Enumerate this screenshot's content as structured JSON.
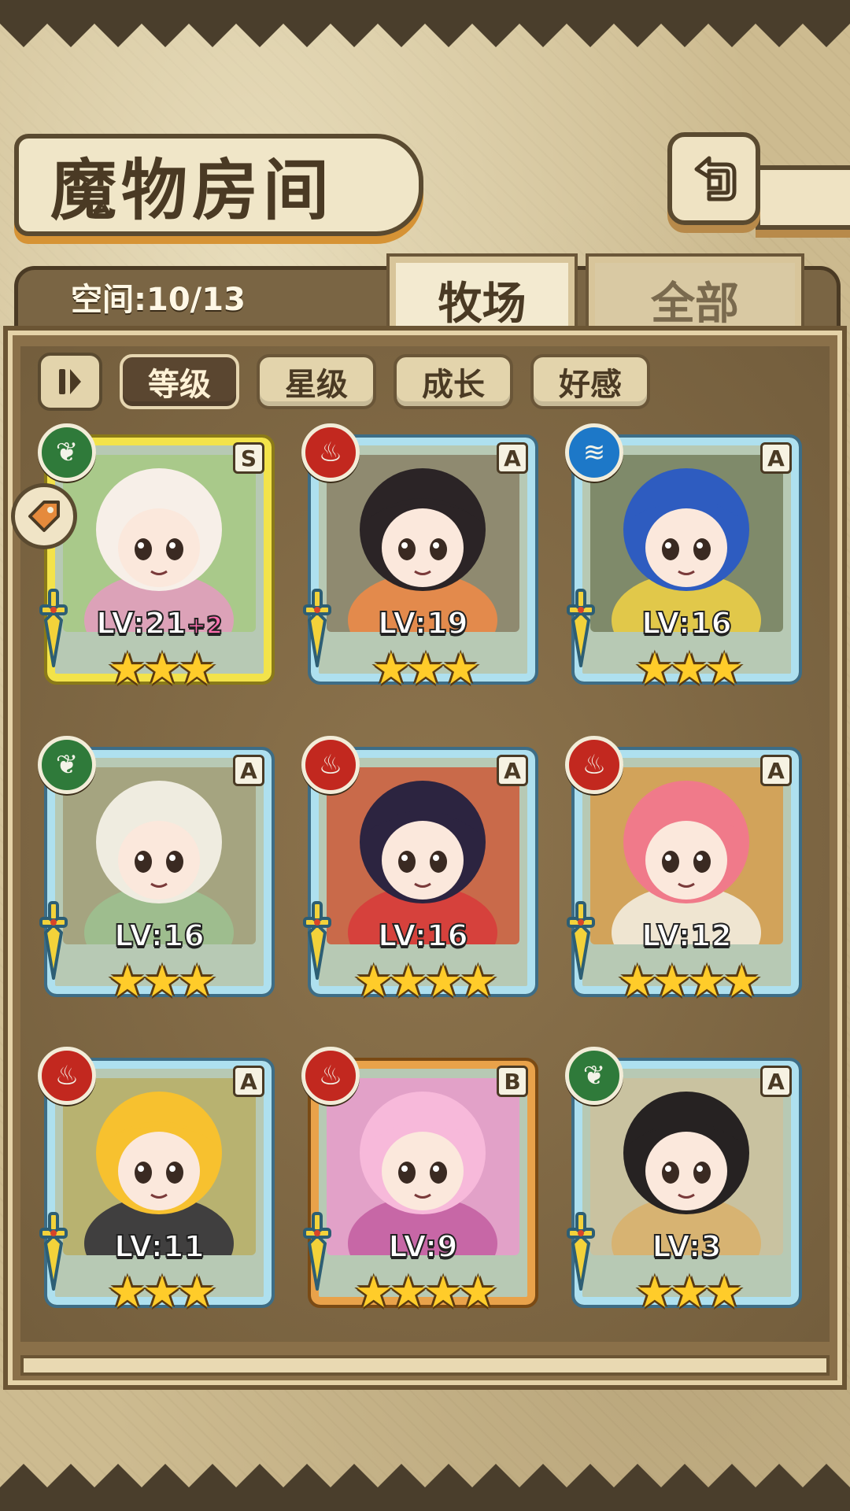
{
  "header": {
    "title": "魔物房间",
    "back_icon": "return-arrow-icon"
  },
  "storage": {
    "space_label": "空间:10/13"
  },
  "tabs": [
    {
      "label": "牧场",
      "active": true
    },
    {
      "label": "全部",
      "active": false
    }
  ],
  "sort": {
    "toggle_icon": "pause-sort-icon",
    "buttons": [
      {
        "label": "等级",
        "active": true
      },
      {
        "label": "星级",
        "active": false
      },
      {
        "label": "成长",
        "active": false
      },
      {
        "label": "好感",
        "active": false
      }
    ]
  },
  "monsters": [
    {
      "element": "grass",
      "rank": "S",
      "level": "LV:21",
      "bonus": "+2",
      "stars": 3,
      "frame": "#f3e34a",
      "palette": [
        "#a9c98a",
        "#f7efe8",
        "#e59bbf"
      ]
    },
    {
      "element": "fire",
      "rank": "A",
      "level": "LV:19",
      "bonus": "",
      "stars": 3,
      "frame": "#aee0ef",
      "palette": [
        "#8f8a70",
        "#2b2426",
        "#f28a45"
      ]
    },
    {
      "element": "water",
      "rank": "A",
      "level": "LV:16",
      "bonus": "",
      "stars": 3,
      "frame": "#aee0ef",
      "palette": [
        "#7f8a6a",
        "#2e5cc0",
        "#f2d244"
      ]
    },
    {
      "element": "grass",
      "rank": "A",
      "level": "LV:16",
      "bonus": "",
      "stars": 3,
      "frame": "#aee0ef",
      "palette": [
        "#a5a480",
        "#efece0",
        "#9cc290"
      ]
    },
    {
      "element": "fire",
      "rank": "A",
      "level": "LV:16",
      "bonus": "",
      "stars": 4,
      "frame": "#aee0ef",
      "palette": [
        "#c96a4a",
        "#2c2440",
        "#d83a3a"
      ]
    },
    {
      "element": "fire",
      "rank": "A",
      "level": "LV:12",
      "bonus": "",
      "stars": 4,
      "frame": "#aee0ef",
      "palette": [
        "#d2a35a",
        "#f07a8a",
        "#f5f1e6"
      ]
    },
    {
      "element": "fire",
      "rank": "A",
      "level": "LV:11",
      "bonus": "",
      "stars": 3,
      "frame": "#aee0ef",
      "palette": [
        "#b8b270",
        "#f7c12f",
        "#2a2a36"
      ]
    },
    {
      "element": "fire",
      "rank": "B",
      "level": "LV:9",
      "bonus": "",
      "stars": 4,
      "frame": "#e9a24a",
      "palette": [
        "#e2a1c8",
        "#f7b9da",
        "#c25da0"
      ]
    },
    {
      "element": "grass",
      "rank": "A",
      "level": "LV:3",
      "bonus": "",
      "stars": 3,
      "frame": "#aee0ef",
      "palette": [
        "#c9c2a0",
        "#262222",
        "#d9b06a"
      ]
    }
  ],
  "element_glyphs": {
    "grass": "❦",
    "fire": "♨",
    "water": "≋"
  },
  "star_glyph": "★"
}
